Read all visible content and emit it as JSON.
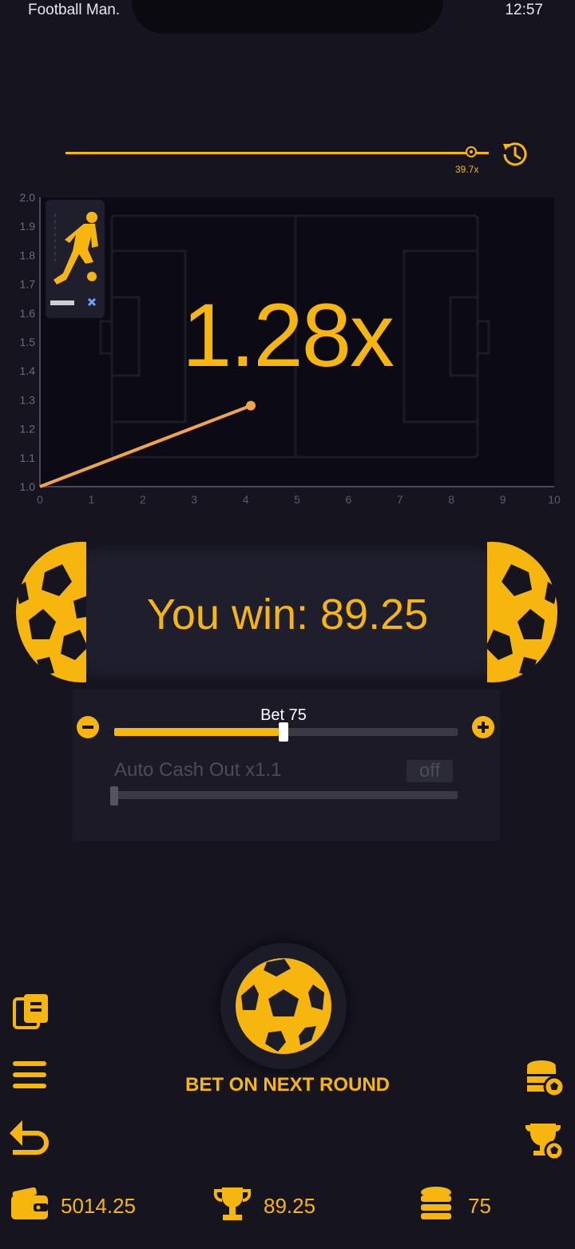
{
  "status_bar": {
    "app_title": "Football Man.",
    "time": "12:57"
  },
  "history": {
    "last_multiplier": "39.7x"
  },
  "game": {
    "current_multiplier": "1.28x",
    "win_message": "You win: 89.25"
  },
  "chart_data": {
    "type": "line",
    "x_ticks": [
      "0",
      "1",
      "2",
      "3",
      "4",
      "5",
      "6",
      "7",
      "8",
      "9",
      "10"
    ],
    "y_ticks": [
      "1.0",
      "1.1",
      "1.2",
      "1.3",
      "1.4",
      "1.5",
      "1.6",
      "1.7",
      "1.8",
      "1.9",
      "2.0"
    ],
    "xlim": [
      0,
      10
    ],
    "ylim": [
      1.0,
      2.0
    ],
    "series": [
      {
        "x": [
          0,
          4.1
        ],
        "y": [
          1.0,
          1.28
        ]
      }
    ],
    "grid": false
  },
  "bet_panel": {
    "bet_label": "Bet 75",
    "bet_fraction": 0.48,
    "auto_cashout_label": "Auto Cash Out x1.1",
    "auto_cashout_state": "off"
  },
  "action": {
    "bet_button_label": "BET ON NEXT ROUND"
  },
  "footer": {
    "balance": "5014.25",
    "winnings": "89.25",
    "bet": "75"
  },
  "colors": {
    "accent": "#f6b60d",
    "background": "#15141f",
    "panel": "#1f1e2d",
    "line": "#f0a347"
  },
  "icons": [
    "history-icon",
    "clipboard-icon",
    "menu-icon",
    "back-icon",
    "coins-ball-icon",
    "trophy-ball-icon",
    "wallet-icon",
    "trophy-icon",
    "coins-icon",
    "soccer-ball-icon"
  ]
}
